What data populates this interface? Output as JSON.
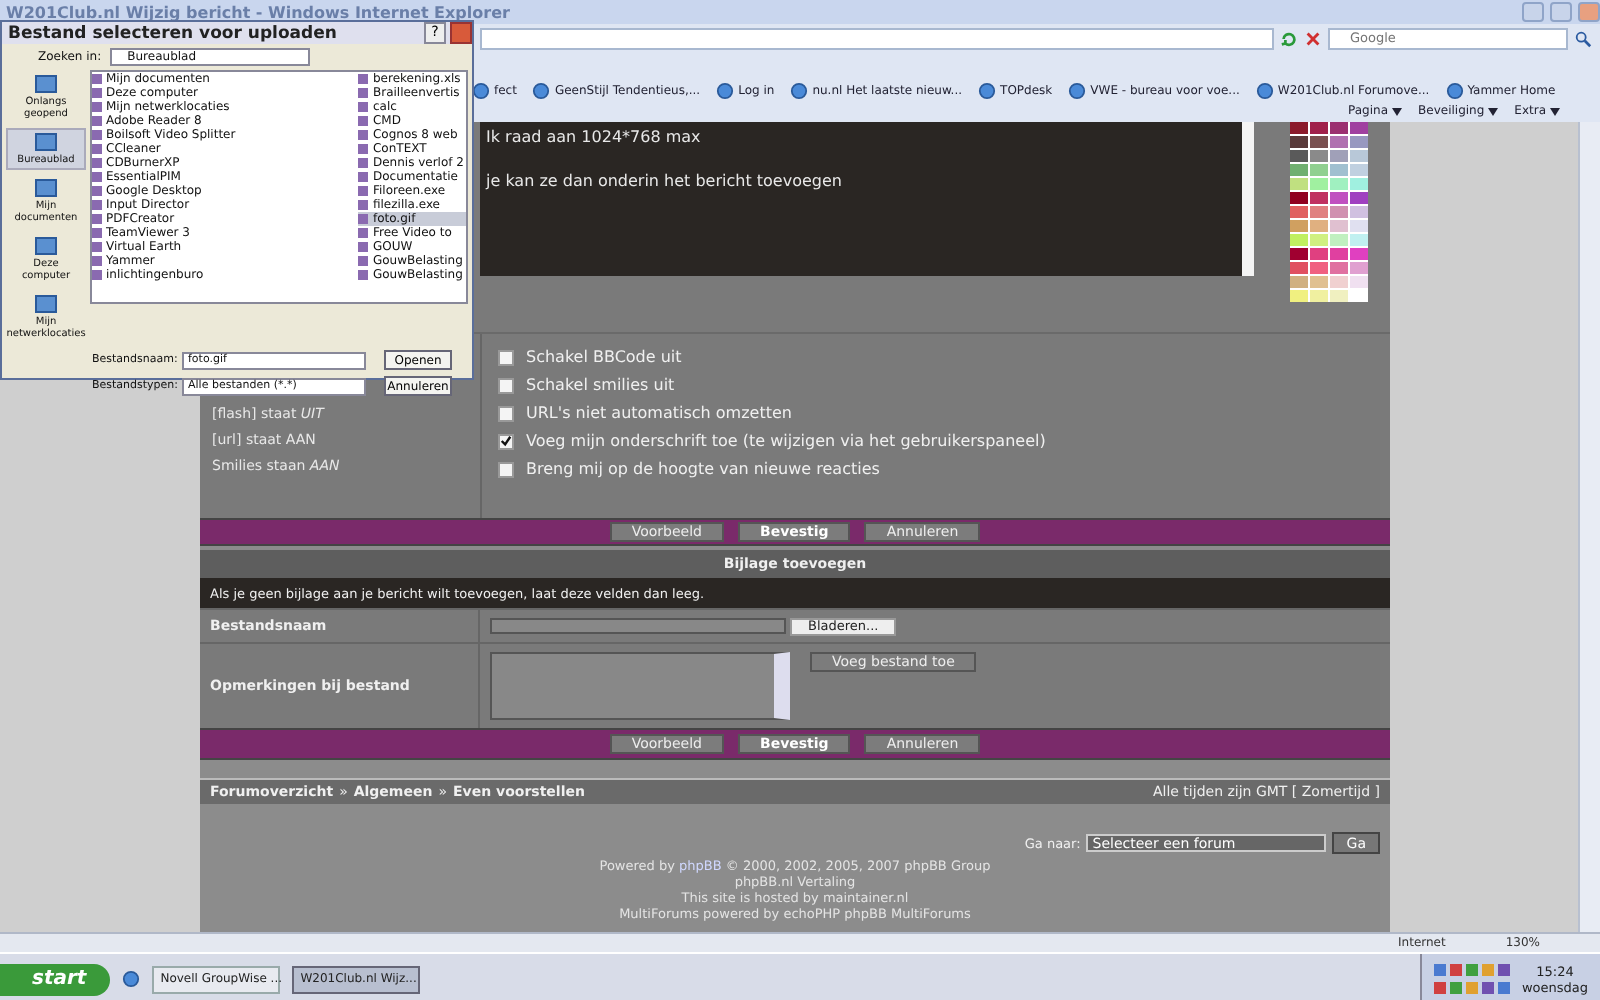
{
  "browser": {
    "title": "W201Club.nl Wijzig bericht - Windows Internet Explorer",
    "search_placeholder": "Google",
    "favorites": [
      {
        "label": "fect"
      },
      {
        "label": "GeenStijl  Tendentieus,..."
      },
      {
        "label": "Log in"
      },
      {
        "label": "nu.nl  Het laatste nieuw..."
      },
      {
        "label": "TOPdesk"
      },
      {
        "label": "VWE - bureau voor voe..."
      },
      {
        "label": "W201Club.nl Forumove..."
      },
      {
        "label": "Yammer  Home"
      }
    ],
    "commands": [
      "Pagina",
      "Beveiliging",
      "Extra"
    ]
  },
  "editor": {
    "lines": [
      "Ik raad aan 1024*768 max",
      "je kan ze dan onderin het bericht toevoegen"
    ]
  },
  "status_lines": [
    "[flash] staat *UIT*",
    "[url] staat AAN",
    "Smilies staan *AAN*"
  ],
  "options": [
    {
      "label": "Schakel BBCode uit",
      "checked": false
    },
    {
      "label": "Schakel smilies uit",
      "checked": false
    },
    {
      "label": "URL's niet automatisch omzetten",
      "checked": false
    },
    {
      "label": "Voeg mijn onderschrift toe (te wijzigen via het gebruikerspaneel)",
      "checked": true
    },
    {
      "label": "Breng mij op de hoogte van nieuwe reacties",
      "checked": false
    }
  ],
  "buttons": [
    {
      "label": "Voorbeeld",
      "kind": "normal"
    },
    {
      "label": "Bevestig",
      "kind": "primary"
    },
    {
      "label": "Annuleren",
      "kind": "normal"
    }
  ],
  "attachment": {
    "heading": "Bijlage toevoegen",
    "hint": "Als je geen bijlage aan je bericht wilt toevoegen, laat deze velden dan leeg.",
    "filename_label": "Bestandsnaam",
    "browse_button": "Bladeren...",
    "comment_label": "Opmerkingen bij bestand",
    "add_button": "Voeg bestand toe"
  },
  "buttons_bottom": [
    {
      "label": "Voorbeeld",
      "kind": "normal"
    },
    {
      "label": "Bevestig",
      "kind": "primary"
    },
    {
      "label": "Annuleren",
      "kind": "normal"
    }
  ],
  "breadcrumb": {
    "items": [
      "Forumoverzicht",
      "Algemeen",
      "Even voorstellen"
    ],
    "separator": "»"
  },
  "timezone": "Alle tijden zijn GMT [ Zomertijd ]",
  "jump": {
    "label": "Ga naar:",
    "value": "Selecteer een forum",
    "button": "Ga"
  },
  "footer": {
    "powered_prefix": "Powered by",
    "powered_link": "phpBB",
    "powered_suffix": "© 2000, 2002, 2005, 2007 phpBB Group",
    "lines": [
      "phpBB.nl Vertaling",
      "This site is hosted by maintainer.nl",
      "MultiForums powered by echoPHP phpBB MultiForums"
    ]
  },
  "status_bar": {
    "zone": "Internet",
    "zoom": "130%"
  },
  "taskbar": {
    "start": "start",
    "tasks": [
      {
        "label": "Novell GroupWise ...",
        "selected": false
      },
      {
        "label": "W201Club.nl Wijz...",
        "selected": true
      }
    ],
    "time": "15:24",
    "day": "woensdag"
  },
  "dialog": {
    "title": "Bestand selecteren voor uploaden",
    "help": "?",
    "look_in_label": "Zoeken in:",
    "look_in_value": "Bureaublad",
    "places": [
      {
        "label": "Onlangs geopend",
        "selected": false
      },
      {
        "label": "Bureaublad",
        "selected": true
      },
      {
        "label": "Mijn documenten",
        "selected": false
      },
      {
        "label": "Deze computer",
        "selected": false
      },
      {
        "label": "Mijn netwerklocaties",
        "selected": false
      }
    ],
    "files_1": [
      {
        "name": "Mijn documenten",
        "selected": false
      },
      {
        "name": "Deze computer",
        "selected": false
      },
      {
        "name": "Mijn netwerklocaties",
        "selected": false
      },
      {
        "name": "Adobe Reader 8",
        "selected": false
      },
      {
        "name": "Boilsoft Video Splitter",
        "selected": false
      },
      {
        "name": "CCleaner",
        "selected": false
      },
      {
        "name": "CDBurnerXP",
        "selected": false
      },
      {
        "name": "EssentialPIM",
        "selected": false
      },
      {
        "name": "Google Desktop",
        "selected": false
      },
      {
        "name": "Input Director",
        "selected": false
      },
      {
        "name": "PDFCreator",
        "selected": false
      },
      {
        "name": "TeamViewer 3",
        "selected": false
      },
      {
        "name": "Virtual Earth",
        "selected": false
      },
      {
        "name": "Yammer",
        "selected": false
      },
      {
        "name": "inlichtingenburo",
        "selected": false
      }
    ],
    "files_2": [
      {
        "name": "berekening.xls",
        "selected": false
      },
      {
        "name": "Brailleenvertis",
        "selected": false
      },
      {
        "name": "calc",
        "selected": false
      },
      {
        "name": "CMD",
        "selected": false
      },
      {
        "name": "Cognos 8 web",
        "selected": false
      },
      {
        "name": "ConTEXT",
        "selected": false
      },
      {
        "name": "Dennis verlof 2",
        "selected": false
      },
      {
        "name": "Documentatie",
        "selected": false
      },
      {
        "name": "Filoreen.exe",
        "selected": false
      },
      {
        "name": "filezilla.exe",
        "selected": false
      },
      {
        "name": "foto.gif",
        "selected": true
      },
      {
        "name": "Free Video to",
        "selected": false
      },
      {
        "name": "GOUW",
        "selected": false
      },
      {
        "name": "GouwBelasting",
        "selected": false
      },
      {
        "name": "GouwBelasting",
        "selected": false
      }
    ],
    "filename_label": "Bestandsnaam:",
    "filename_value": "foto.gif",
    "type_label": "Bestandstypen:",
    "type_value": "Alle bestanden (*.*)",
    "open_button": "Openen",
    "cancel_button": "Annuleren"
  }
}
